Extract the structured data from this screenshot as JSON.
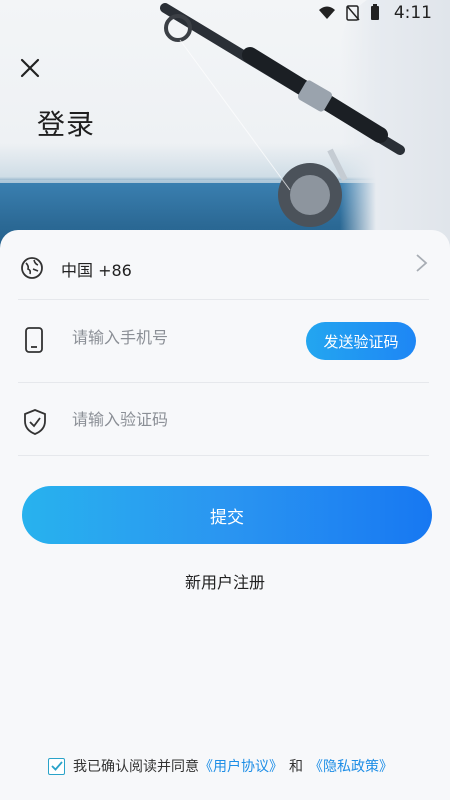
{
  "status_bar": {
    "time": "4:11"
  },
  "page": {
    "title": "登录"
  },
  "form": {
    "country_label": "中国 +86",
    "phone_placeholder": "请输入手机号",
    "send_code_label": "发送验证码",
    "code_placeholder": "请输入验证码",
    "submit_label": "提交"
  },
  "register_label": "新用户注册",
  "agreement": {
    "prefix": "我已确认阅读并同意",
    "user_agreement": "《用户协议》",
    "and": "和",
    "privacy_policy": "《隐私政策》",
    "checked": true
  },
  "colors": {
    "accent": "#1e86f5",
    "accent_light": "#28b2ee",
    "link": "#1e8ee6",
    "checkbox": "#2aa3c9"
  },
  "icons": {
    "close": "close-icon",
    "globe": "globe-icon",
    "chevron": "chevron-right-icon",
    "phone": "phone-icon",
    "shield": "shield-check-icon"
  }
}
